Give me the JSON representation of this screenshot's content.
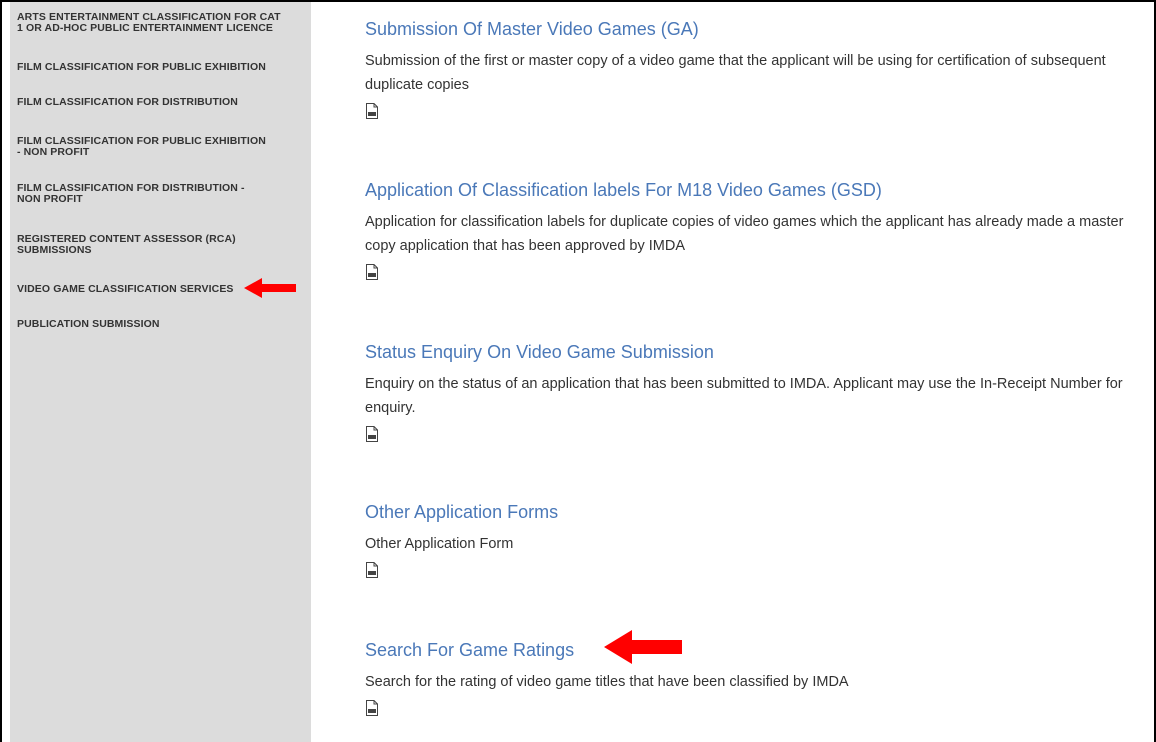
{
  "sidebar": {
    "items": [
      {
        "lines": [
          "ARTS ENTERTAINMENT CLASSIFICATION FOR CAT",
          "1 OR AD-HOC PUBLIC ENTERTAINMENT LICENCE"
        ]
      },
      {
        "lines": [
          "FILM CLASSIFICATION FOR PUBLIC EXHIBITION"
        ]
      },
      {
        "lines": [
          "FILM CLASSIFICATION FOR DISTRIBUTION"
        ]
      },
      {
        "lines": [
          "FILM CLASSIFICATION FOR PUBLIC EXHIBITION",
          "- NON PROFIT"
        ]
      },
      {
        "lines": [
          "FILM CLASSIFICATION FOR DISTRIBUTION -",
          "NON PROFIT"
        ]
      },
      {
        "lines": [
          "REGISTERED CONTENT ASSESSOR (RCA)",
          "SUBMISSIONS"
        ]
      },
      {
        "lines": [
          "VIDEO GAME CLASSIFICATION SERVICES"
        ]
      },
      {
        "lines": [
          "PUBLICATION SUBMISSION"
        ]
      }
    ]
  },
  "entries": [
    {
      "title": "Submission Of Master Video Games (GA)",
      "description": "Submission of the first or master copy of a video game that the applicant will be using for certification of subsequent duplicate copies"
    },
    {
      "title": "Application Of Classification labels For M18 Video Games (GSD)",
      "description": "Application for classification labels for duplicate copies of video games which the applicant has already made a master copy application that has been approved by IMDA"
    },
    {
      "title": "Status Enquiry On Video Game Submission",
      "description": "Enquiry on the status of an application that has been submitted to IMDA. Applicant may use the In-Receipt Number for enquiry."
    },
    {
      "title": "Other Application Forms",
      "description": "Other Application Form"
    },
    {
      "title": "Search For Game Ratings",
      "description": "Search for the rating of video game titles that have been classified by IMDA"
    }
  ],
  "icons": {
    "pdf": "pdf-file-icon",
    "arrow": "red-arrow-left-icon"
  },
  "colors": {
    "link": "#4a78b8",
    "sidebar_bg": "#dcdcdc",
    "arrow": "#ff0000"
  }
}
